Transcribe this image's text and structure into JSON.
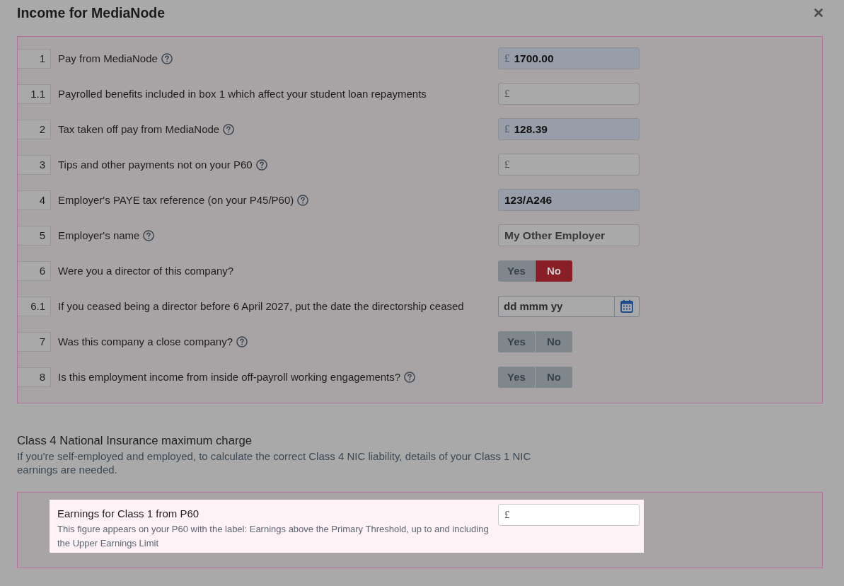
{
  "dialog": {
    "title": "Income for MediaNode"
  },
  "questions": [
    {
      "number": "1",
      "label": "Pay from MediaNode",
      "help": true,
      "kind": "currency",
      "prefix": "£",
      "value": "1700.00",
      "highlighted": true
    },
    {
      "number": "1.1",
      "label": "Payrolled benefits included in box 1 which affect your student loan repayments",
      "help": false,
      "kind": "currency",
      "prefix": "£",
      "highlighted": false
    },
    {
      "number": "2",
      "label": "Tax taken off pay from MediaNode",
      "help": true,
      "kind": "currency",
      "prefix": "£",
      "value": "128.39",
      "highlighted": true
    },
    {
      "number": "3",
      "label": "Tips and other payments not on your P60",
      "help": true,
      "kind": "currency",
      "prefix": "£",
      "highlighted": false
    },
    {
      "number": "4",
      "label": "Employer's PAYE tax reference (on your P45/P60)",
      "help": true,
      "kind": "text",
      "value": "123/A246",
      "highlighted": true
    },
    {
      "number": "5",
      "label": "Employer's name",
      "help": true,
      "kind": "text",
      "value": "My Other Employer",
      "highlighted": false
    },
    {
      "number": "6",
      "label": "Were you a director of this company?",
      "help": false,
      "kind": "choice",
      "options": [
        {
          "label": "Yes",
          "selected": false
        },
        {
          "label": "No",
          "selected": true
        }
      ]
    },
    {
      "number": "6.1",
      "label": "If you ceased being a director before 6 April 2027, put the date the directorship ceased",
      "help": false,
      "kind": "date",
      "placeholder": "dd mmm yy"
    },
    {
      "number": "7",
      "label": "Was this company a close company?",
      "help": true,
      "kind": "choice",
      "options": [
        {
          "label": "Yes",
          "selected": false
        },
        {
          "label": "No",
          "selected": false
        }
      ]
    },
    {
      "number": "8",
      "label": "Is this employment income from inside off-payroll working engagements?",
      "help": true,
      "kind": "choice",
      "options": [
        {
          "label": "Yes",
          "selected": false
        },
        {
          "label": "No",
          "selected": false
        }
      ]
    }
  ],
  "class4": {
    "heading": "Class 4 National Insurance maximum charge",
    "description": "If you're self-employed and employed, to calculate the correct Class 4 NIC liability, details of your Class 1 NIC earnings are needed.",
    "field": {
      "label": "Earnings for Class 1 from P60",
      "hint": "This figure appears on your P60 with the label: Earnings above the Primary Threshold, up to and including the Upper Earnings Limit",
      "prefix": "£"
    }
  }
}
